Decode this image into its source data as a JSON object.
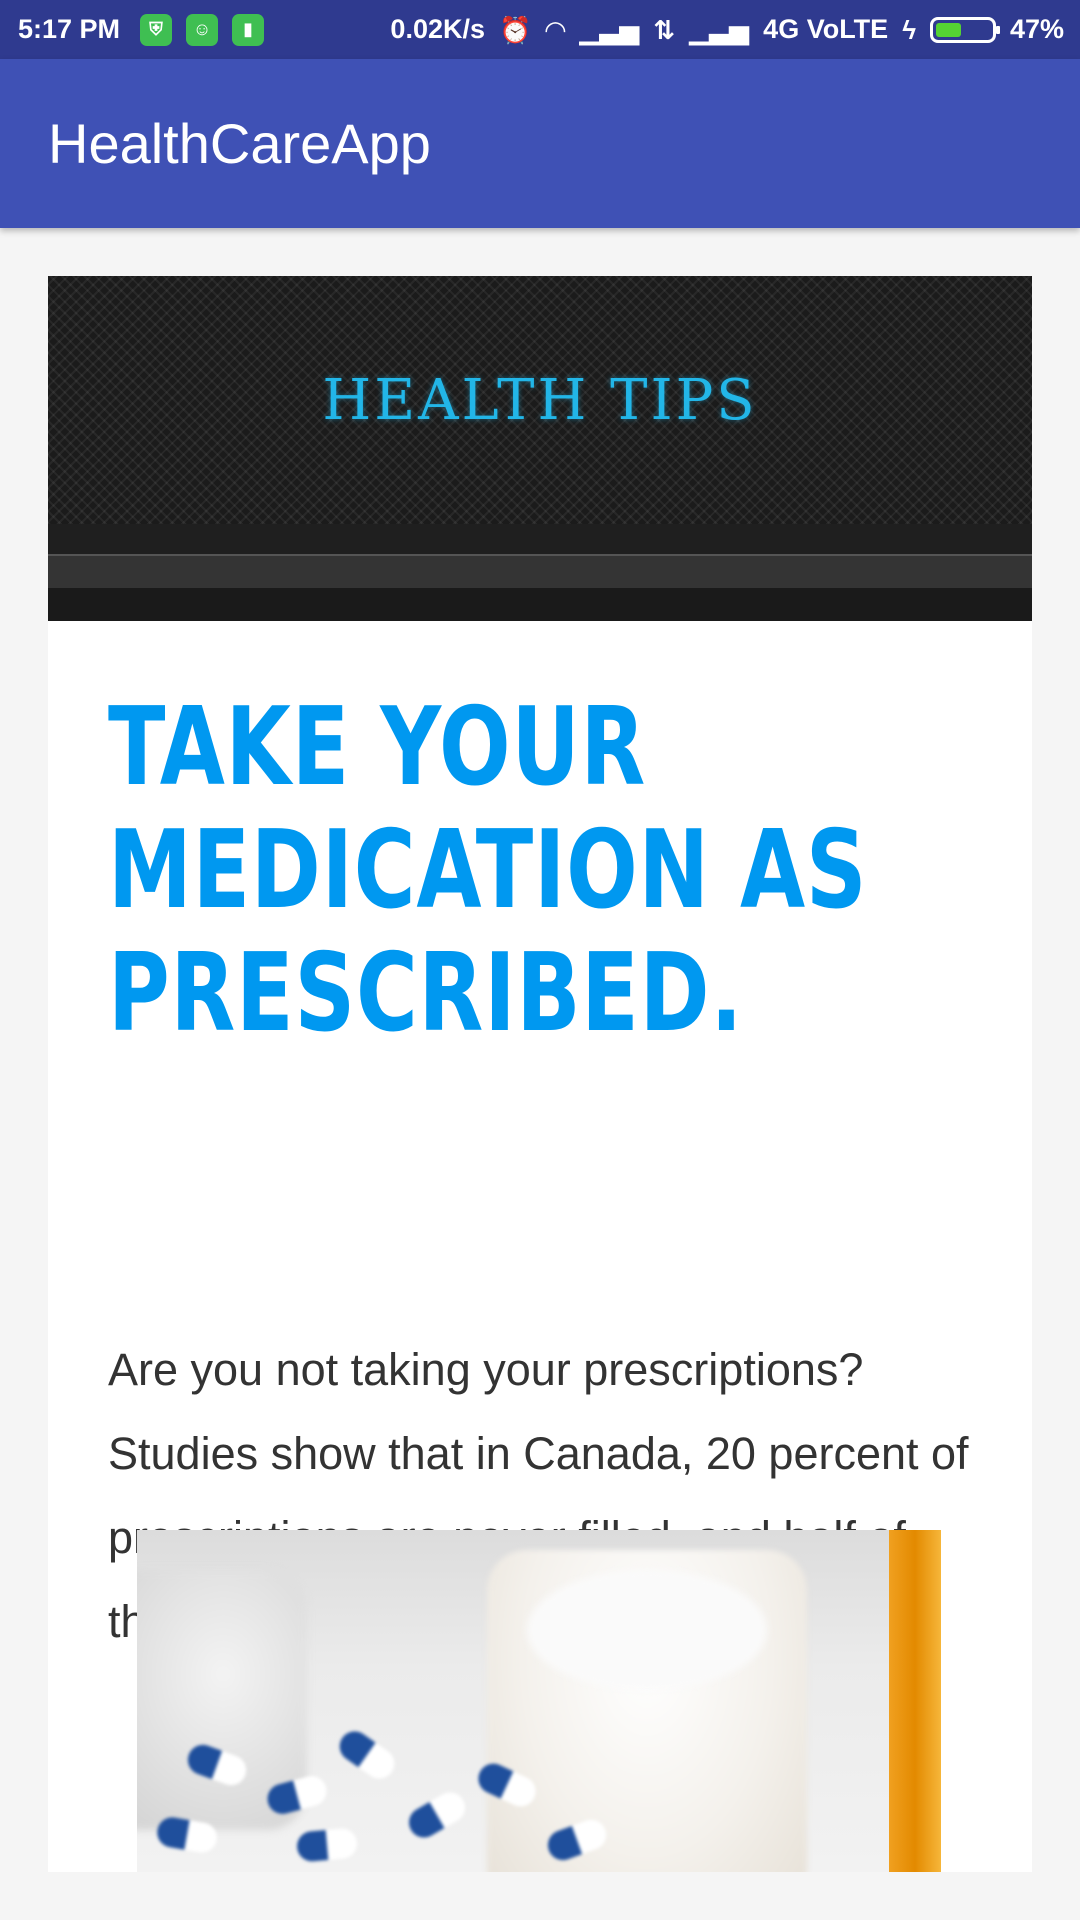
{
  "status_bar": {
    "time": "5:17 PM",
    "net_speed": "0.02K/s",
    "network": "4G VoLTE",
    "battery_percent": "47%",
    "battery_level": 0.47,
    "icons": [
      "shield-app-icon",
      "android-app-icon",
      "battery-app-icon",
      "alarm-icon",
      "wifi-icon",
      "signal-icon",
      "data-arrows-icon",
      "signal-icon",
      "charging-icon",
      "battery-icon"
    ]
  },
  "app_bar": {
    "title": "HealthCareApp",
    "color": "#3f51b5"
  },
  "article": {
    "banner_text": "HEALTH TIPS",
    "headline_lines": [
      "TAKE YOUR",
      "MEDICATION AS",
      "PRESCRIBED."
    ],
    "body": "Are you not taking your prescriptions? Studies show that in Canada, 20 percent of prescriptions are never filled, and half of those that are filled are taken incorrectly.",
    "headline_color": "#0098f0",
    "photo_subject": "medication-bottles-and-pills"
  }
}
